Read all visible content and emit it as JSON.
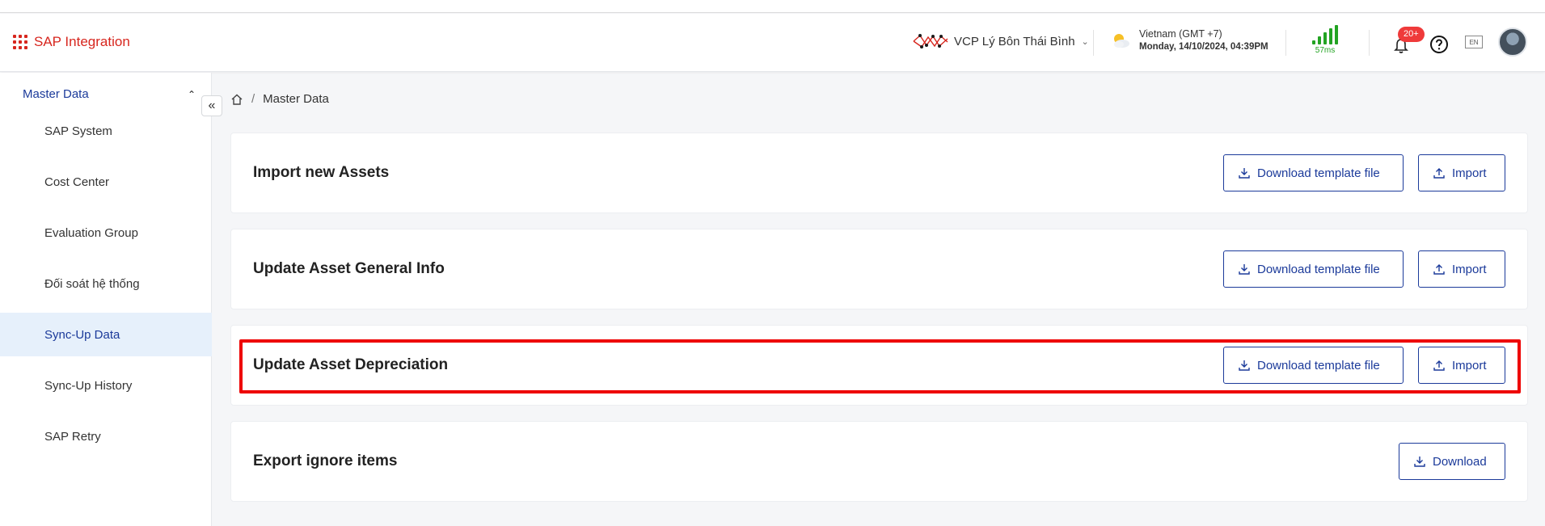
{
  "header": {
    "app_title": "SAP Integration",
    "site_name": "VCP Lý Bôn Thái Bình",
    "timezone": "Vietnam (GMT +7)",
    "datetime": "Monday, 14/10/2024, 04:39PM",
    "latency": "57ms",
    "notification_count": "20+",
    "language": "EN",
    "signal_color": "#22a322",
    "brand_color": "#d7261e"
  },
  "sidebar": {
    "group_label": "Master Data",
    "items": [
      {
        "label": "SAP System"
      },
      {
        "label": "Cost Center"
      },
      {
        "label": "Evaluation Group"
      },
      {
        "label": "Đối soát hệ thống"
      },
      {
        "label": "Sync-Up Data",
        "active": true
      },
      {
        "label": "Sync-Up History"
      },
      {
        "label": "SAP Retry"
      }
    ]
  },
  "breadcrumb": {
    "current": "Master Data"
  },
  "cards": [
    {
      "title": "Import new Assets",
      "download_label": "Download template file",
      "import_label": "Import"
    },
    {
      "title": "Update Asset General Info",
      "download_label": "Download template file",
      "import_label": "Import"
    },
    {
      "title": "Update Asset Depreciation",
      "download_label": "Download template file",
      "import_label": "Import",
      "highlighted": true
    },
    {
      "title": "Export ignore items",
      "download_label": "Download"
    }
  ],
  "accent_color": "#1b3a9a",
  "highlight_color": "#ee0000"
}
